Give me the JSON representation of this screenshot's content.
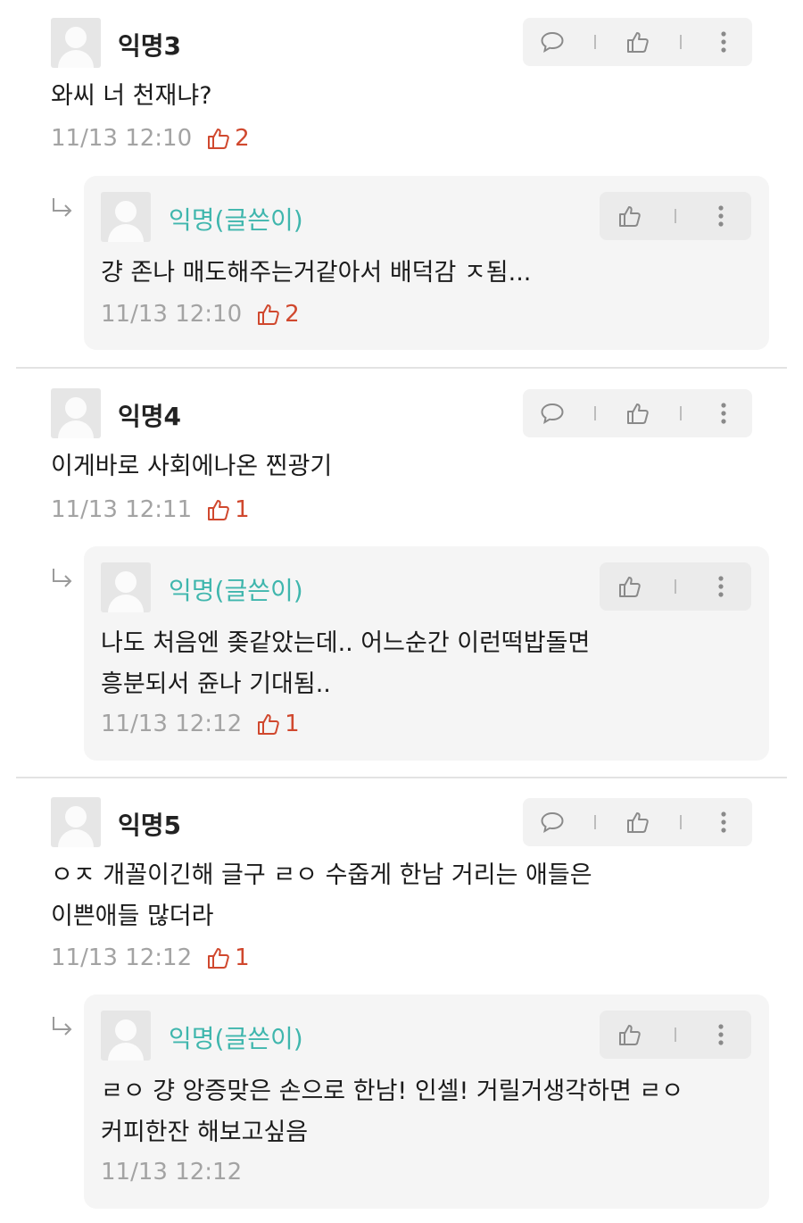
{
  "threads": [
    {
      "comment": {
        "name": "익명3",
        "text": "와씨 너 천재냐?",
        "time": "11/13 12:10",
        "likes": "2"
      },
      "reply": {
        "name": "익명(글쓴이)",
        "text": "걍 존나 매도해주는거같아서 배덕감 ㅈ됨...",
        "time": "11/13 12:10",
        "likes": "2"
      }
    },
    {
      "comment": {
        "name": "익명4",
        "text": "이게바로 사회에나온 찐광기",
        "time": "11/13 12:11",
        "likes": "1"
      },
      "reply": {
        "name": "익명(글쓴이)",
        "text": "나도 처음엔 좆같았는데.. 어느순간 이런떡밥돌면\n흥분되서 쥰나 기대됨..",
        "time": "11/13 12:12",
        "likes": "1"
      }
    },
    {
      "comment": {
        "name": "익명5",
        "text": "ㅇㅈ 개꼴이긴해 글구 ㄹㅇ 수줍게 한남 거리는 애들은\n이쁜애들 많더라",
        "time": "11/13 12:12",
        "likes": "1"
      },
      "reply": {
        "name": "익명(글쓴이)",
        "text": "ㄹㅇ 걍 앙증맞은 손으로 한남! 인셀! 거릴거생각하면 ㄹㅇ\n커피한잔 해보고싶음",
        "time": "11/13 12:12",
        "likes": ""
      }
    }
  ],
  "icons": {
    "comment": "speech-bubble-icon",
    "like": "thumbs-up-icon",
    "more": "vertical-dots-icon",
    "reply": "reply-arrow-icon",
    "avatar": "default-avatar-icon"
  },
  "colors": {
    "writer_name": "#3fb6ad",
    "like_count": "#d0482e",
    "meta": "#a3a3a3",
    "reply_bg": "#f5f5f5",
    "action_bg": "#f2f2f2"
  }
}
